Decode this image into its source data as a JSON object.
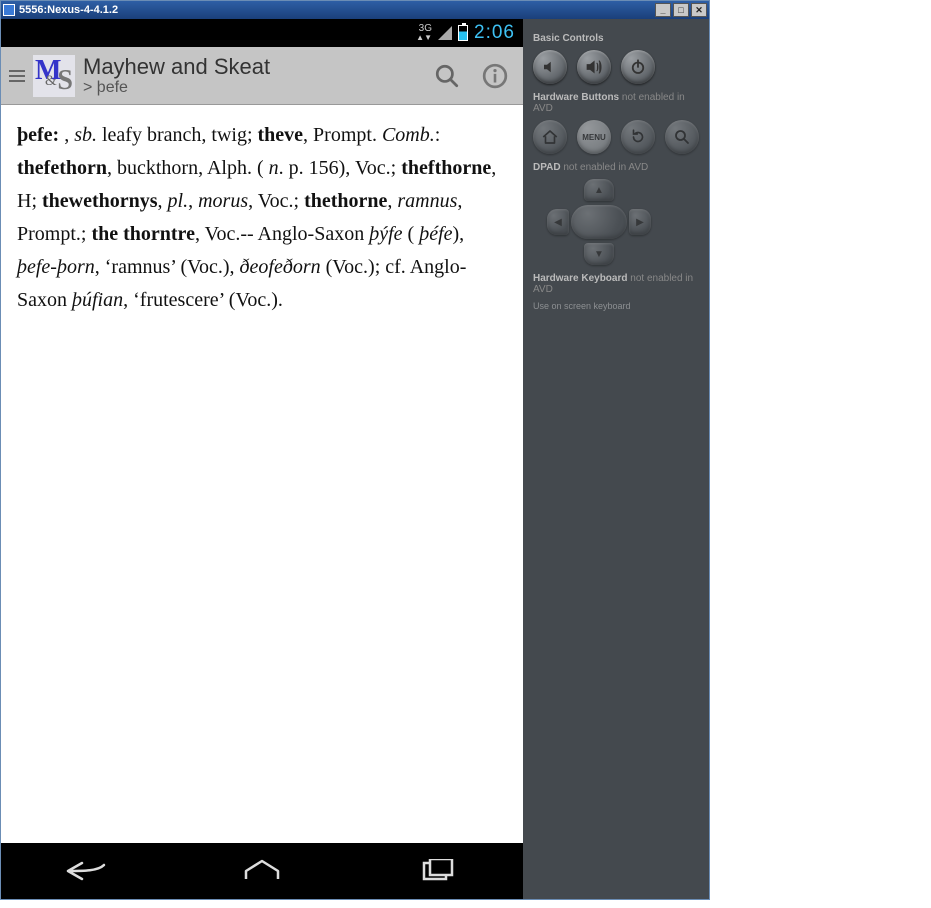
{
  "window": {
    "title": "5556:Nexus-4-4.1.2"
  },
  "statusbar": {
    "network_label": "3G",
    "clock": "2:06"
  },
  "appbar": {
    "logo_m": "M",
    "logo_amp": "&",
    "logo_s": "S",
    "title": "Mayhew and Skeat",
    "subtitle": "> þefe"
  },
  "entry": {
    "headword": "þefe:",
    "t01": " , ",
    "i_sb": "sb.",
    "t02": " leafy branch, twig; ",
    "b_theve": "theve",
    "t03": ", Prompt. ",
    "i_comb": "Comb.",
    "t04": ": ",
    "b_thefethorn": "thefethorn",
    "t05": ", buckthorn, Alph. ( ",
    "i_n": "n",
    "t06": ". p. 156), Voc.; ",
    "b_thefthorne": "thefthorne",
    "t07": ", H; ",
    "b_thewethornys": "thewethornys",
    "t08": ", ",
    "i_pl": "pl.",
    "t09": ", ",
    "i_morus": "morus",
    "t10": ", Voc.; ",
    "b_thethorne": "thethorne",
    "t11": ", ",
    "i_ramnus": "ramnus",
    "t12": ", Prompt.; ",
    "b_thethorntre": "the thorntre",
    "t13": ", Voc.-- Anglo-Saxon ",
    "i_thyfe": "þýfe",
    "t14": " ( ",
    "i_thefe2": "þéfe",
    "t15": "), ",
    "i_thefethorn2": "þefe-þorn",
    "t16": ", ‘ramnus’ (Voc.), ",
    "i_deofe": "ðeofeðorn",
    "t17": " (Voc.); cf. Anglo-Saxon ",
    "i_thufian": "þúfian",
    "t18": ", ‘frutescere’ (Voc.)."
  },
  "side": {
    "basic_controls": "Basic Controls",
    "hardware_buttons": "Hardware Buttons",
    "hb_sub": " not enabled in AVD",
    "menu_label": "MENU",
    "dpad": "DPAD",
    "dpad_sub": " not enabled in AVD",
    "hw_kb": "Hardware Keyboard",
    "hw_kb_sub": " not enabled in AVD",
    "hw_kb_note": "Use on screen keyboard"
  }
}
